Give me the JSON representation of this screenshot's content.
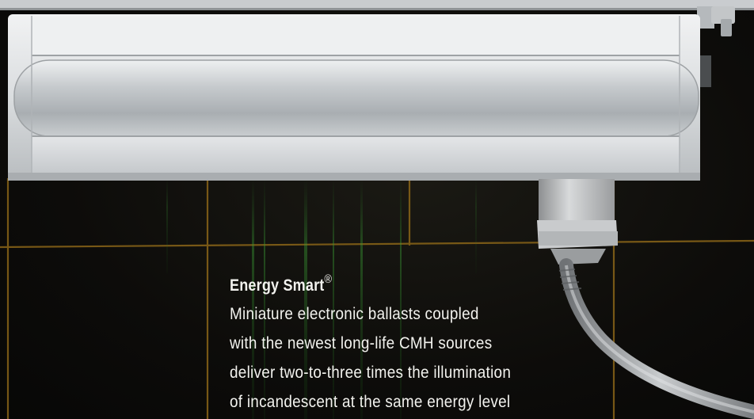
{
  "caption": {
    "title": "Energy Smart",
    "title_mark": "®",
    "lines": [
      "Miniature electronic ballasts coupled",
      "with the newest long-life CMH sources",
      "deliver two-to-three times the illumination",
      "of incandescent at the same energy level"
    ]
  },
  "colors": {
    "background": "#0b0b09",
    "grid_lines": "#8a6518",
    "fixture_body": "#d9dcdf",
    "caption_text": "#f2f2ee"
  }
}
